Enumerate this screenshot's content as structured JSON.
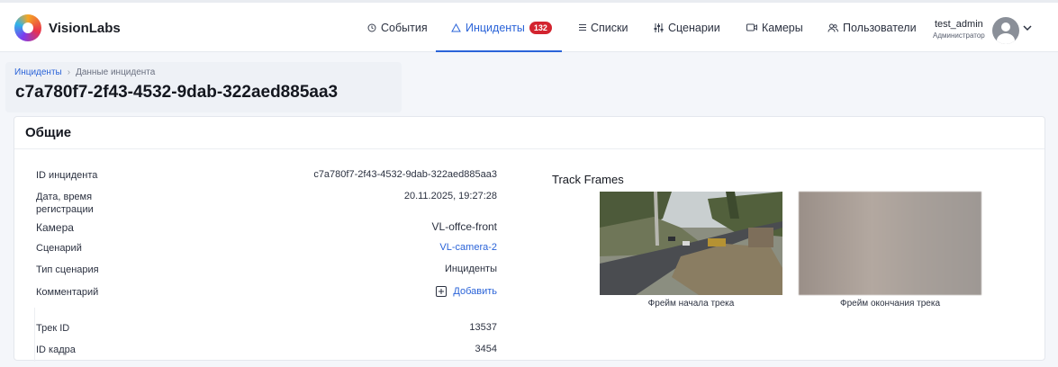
{
  "app": {
    "logo_text": "VisionLabs"
  },
  "nav": {
    "items": [
      {
        "label": "События",
        "icon": "clock-icon"
      },
      {
        "label": "Инциденты",
        "icon": "warning-icon",
        "badge": "132",
        "active": true
      },
      {
        "label": "Списки",
        "icon": "list-icon"
      },
      {
        "label": "Сценарии",
        "icon": "sliders-icon"
      },
      {
        "label": "Камеры",
        "icon": "camera-icon"
      },
      {
        "label": "Пользователи",
        "icon": "users-icon"
      }
    ]
  },
  "user": {
    "name": "test_admin",
    "role": "Администратор"
  },
  "breadcrumb": {
    "parent": "Инциденты",
    "current": "Данные инцидента"
  },
  "page": {
    "title": "c7a780f7-2f43-4532-9dab-322aed885aa3"
  },
  "general": {
    "title": "Общие",
    "rows": [
      {
        "label": "ID инцидента",
        "value": "c7a780f7-2f43-4532-9dab-322aed885aa3"
      },
      {
        "label": "Дата, время регистрации",
        "value": "20.11.2025, 19:27:28"
      },
      {
        "label": "Камера",
        "value": "VL-offce-front"
      },
      {
        "label": "Сценарий",
        "value": "VL-camera-2"
      },
      {
        "label": "Тип сценария",
        "value": "Инциденты"
      },
      {
        "label": "Комментарий",
        "value": "Добавить"
      },
      {
        "label": "Трек ID",
        "value": "13537"
      },
      {
        "label": "ID кадра",
        "value": "3454"
      }
    ]
  },
  "track_frames": {
    "title": "Track Frames",
    "start_caption": "Фрейм начала трека",
    "end_caption": "Фрейм окончания трека"
  },
  "colors": {
    "accent": "#2a63d8",
    "badge": "#d3242f"
  }
}
